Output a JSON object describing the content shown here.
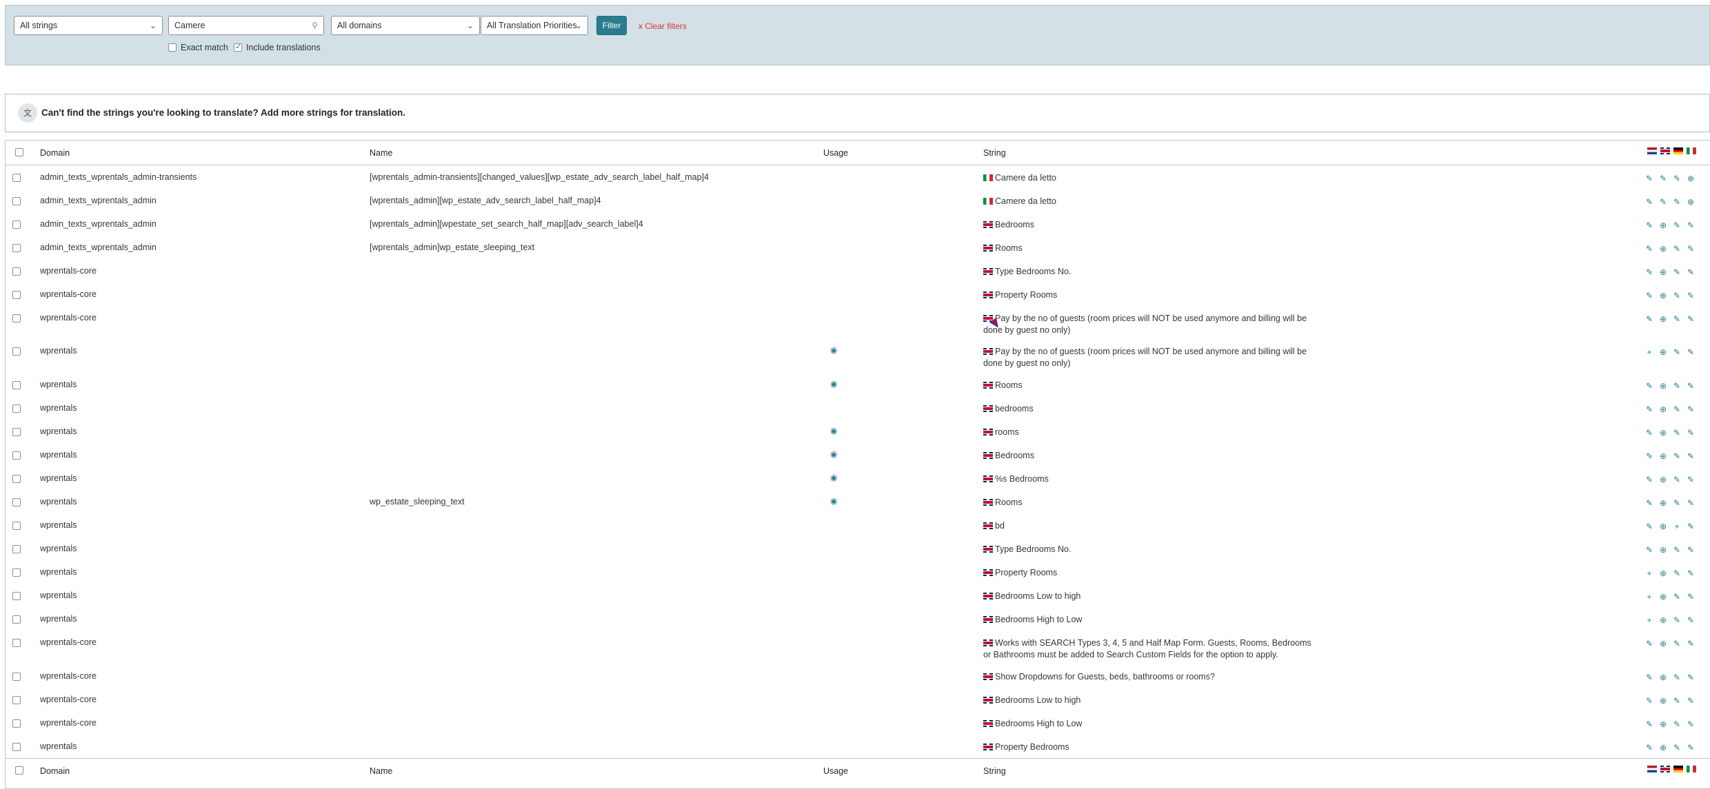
{
  "filters": {
    "strings_select": "All strings",
    "search_value": "Camere",
    "domains_select": "All domains",
    "priorities_select": "All Translation Priorities",
    "filter_button": "Filter",
    "clear_filters": "x Clear filters",
    "exact_match": "Exact match",
    "include_translations": "Include translations"
  },
  "notice": {
    "text": "Can't find the strings you're looking to translate? Add more strings for translation."
  },
  "columns": {
    "domain": "Domain",
    "name": "Name",
    "usage": "Usage",
    "string": "String"
  },
  "rows": [
    {
      "domain": "admin_texts_wprentals_admin-transients",
      "name": "[wprentals_admin-transients][changed_values][wp_estate_adv_search_label_half_map]4",
      "usage": false,
      "flag": "it",
      "string": "Camere da letto",
      "actions": [
        "pencil",
        "pencil",
        "pencil",
        "globe"
      ]
    },
    {
      "domain": "admin_texts_wprentals_admin",
      "name": "[wprentals_admin][wp_estate_adv_search_label_half_map]4",
      "usage": false,
      "flag": "it",
      "string": "Camere da letto",
      "actions": [
        "pencil",
        "pencil",
        "pencil",
        "globe"
      ]
    },
    {
      "domain": "admin_texts_wprentals_admin",
      "name": "[wprentals_admin][wpestate_set_search_half_map][adv_search_label]4",
      "usage": false,
      "flag": "gb",
      "string": "Bedrooms",
      "actions": [
        "pencil",
        "globe",
        "pencil",
        "pencil"
      ]
    },
    {
      "domain": "admin_texts_wprentals_admin",
      "name": "[wprentals_admin]wp_estate_sleeping_text",
      "usage": false,
      "flag": "gb",
      "string": "Rooms",
      "actions": [
        "pencil",
        "globe",
        "pencil",
        "pencil"
      ]
    },
    {
      "domain": "wprentals-core",
      "name": "",
      "usage": false,
      "flag": "gb",
      "string": "Type Bedrooms No.",
      "actions": [
        "pencil",
        "globe",
        "pencil",
        "pencil"
      ]
    },
    {
      "domain": "wprentals-core",
      "name": "",
      "usage": false,
      "flag": "gb",
      "string": "Property Rooms",
      "actions": [
        "pencil",
        "globe",
        "pencil",
        "pencil"
      ]
    },
    {
      "domain": "wprentals-core",
      "name": "",
      "usage": false,
      "flag": "gb",
      "string": "Pay by the no of guests (room prices will NOT be used anymore and billing will be done by guest no only)",
      "actions": [
        "pencil",
        "globe",
        "pencil",
        "pencil"
      ]
    },
    {
      "domain": "wprentals",
      "name": "",
      "usage": true,
      "flag": "gb",
      "string": "Pay by the no of guests (room prices will NOT be used anymore and billing will be done by guest no only)",
      "actions": [
        "plus",
        "globe",
        "pencil",
        "pencil"
      ]
    },
    {
      "domain": "wprentals",
      "name": "",
      "usage": true,
      "flag": "gb",
      "string": "Rooms",
      "actions": [
        "pencil",
        "globe",
        "pencil",
        "pencil"
      ]
    },
    {
      "domain": "wprentals",
      "name": "",
      "usage": false,
      "flag": "gb",
      "string": "bedrooms",
      "actions": [
        "pencil",
        "globe",
        "pencil",
        "pencil"
      ]
    },
    {
      "domain": "wprentals",
      "name": "",
      "usage": true,
      "flag": "gb",
      "string": "rooms",
      "actions": [
        "pencil",
        "globe",
        "pencil",
        "pencil"
      ]
    },
    {
      "domain": "wprentals",
      "name": "",
      "usage": true,
      "flag": "gb",
      "string": "Bedrooms",
      "actions": [
        "pencil",
        "globe",
        "pencil",
        "pencil"
      ]
    },
    {
      "domain": "wprentals",
      "name": "",
      "usage": true,
      "flag": "gb",
      "string": "%s Bedrooms",
      "actions": [
        "pencil",
        "globe",
        "pencil",
        "pencil"
      ]
    },
    {
      "domain": "wprentals",
      "name": "wp_estate_sleeping_text",
      "usage": true,
      "flag": "gb",
      "string": "Rooms",
      "actions": [
        "pencil",
        "globe",
        "pencil",
        "pencil"
      ]
    },
    {
      "domain": "wprentals",
      "name": "",
      "usage": false,
      "flag": "gb",
      "string": "bd",
      "actions": [
        "pencil",
        "globe",
        "plus",
        "pencil"
      ]
    },
    {
      "domain": "wprentals",
      "name": "",
      "usage": false,
      "flag": "gb",
      "string": "Type Bedrooms No.",
      "actions": [
        "pencil",
        "globe",
        "pencil",
        "pencil"
      ]
    },
    {
      "domain": "wprentals",
      "name": "",
      "usage": false,
      "flag": "gb",
      "string": "Property Rooms",
      "actions": [
        "plus",
        "globe",
        "pencil",
        "pencil"
      ]
    },
    {
      "domain": "wprentals",
      "name": "",
      "usage": false,
      "flag": "gb",
      "string": "Bedrooms Low to high",
      "actions": [
        "plus",
        "globe",
        "pencil",
        "pencil"
      ]
    },
    {
      "domain": "wprentals",
      "name": "",
      "usage": false,
      "flag": "gb",
      "string": "Bedrooms High to Low",
      "actions": [
        "plus",
        "globe",
        "pencil",
        "pencil"
      ]
    },
    {
      "domain": "wprentals-core",
      "name": "",
      "usage": false,
      "flag": "gb",
      "string": "Works with SEARCH Types 3, 4, 5 and Half Map Form. Guests, Rooms, Bedrooms or Bathrooms must be added to Search Custom Fields for the option to apply.",
      "actions": [
        "pencil",
        "globe",
        "pencil",
        "pencil"
      ]
    },
    {
      "domain": "wprentals-core",
      "name": "",
      "usage": false,
      "flag": "gb",
      "string": "Show Dropdowns for Guests, beds, bathrooms or rooms?",
      "actions": [
        "pencil",
        "globe",
        "pencil",
        "pencil"
      ]
    },
    {
      "domain": "wprentals-core",
      "name": "",
      "usage": false,
      "flag": "gb",
      "string": "Bedrooms Low to high",
      "actions": [
        "pencil",
        "globe",
        "pencil",
        "pencil"
      ]
    },
    {
      "domain": "wprentals-core",
      "name": "",
      "usage": false,
      "flag": "gb",
      "string": "Bedrooms High to Low",
      "actions": [
        "pencil",
        "globe",
        "pencil",
        "pencil"
      ]
    },
    {
      "domain": "wprentals",
      "name": "",
      "usage": false,
      "flag": "gb",
      "string": "Property Bedrooms",
      "actions": [
        "pencil",
        "globe",
        "pencil",
        "pencil"
      ]
    }
  ]
}
